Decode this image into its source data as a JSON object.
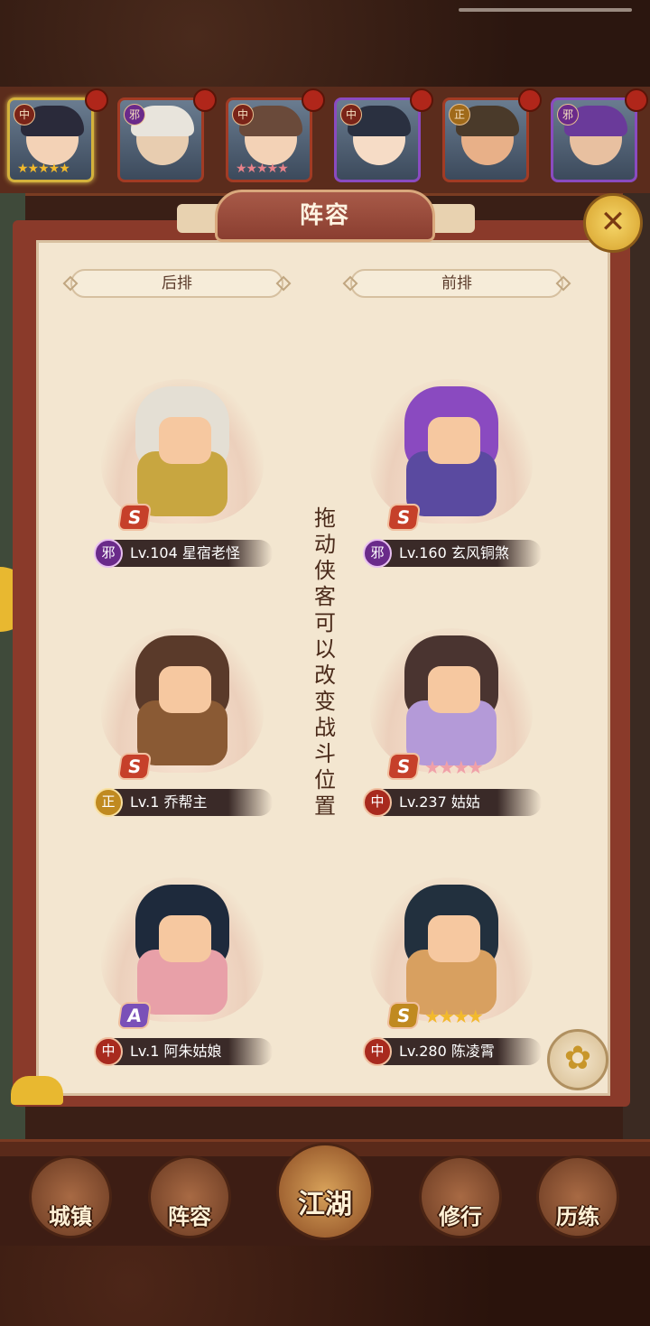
{
  "top_heroes": [
    {
      "faction": "中",
      "stars": "★★★★★",
      "star_color": "gold",
      "face": "#f3d2b6",
      "hair": "#2a2a3a"
    },
    {
      "faction": "邪",
      "stars": "",
      "star_color": "gold",
      "face": "#e8cdb0",
      "hair": "#e8e4dc"
    },
    {
      "faction": "中",
      "stars": "★★★★★",
      "star_color": "pink",
      "face": "#f3d2b6",
      "hair": "#6a4a3a"
    },
    {
      "faction": "中",
      "stars": "",
      "star_color": "gold",
      "face": "#f6dcc6",
      "hair": "#2a3040"
    },
    {
      "faction": "正",
      "stars": "",
      "star_color": "gold",
      "face": "#e8b088",
      "hair": "#4a3a2a"
    },
    {
      "faction": "邪",
      "stars": "",
      "star_color": "gold",
      "face": "#e8c0a0",
      "hair": "#6a3a9a"
    }
  ],
  "panel": {
    "title": "阵容",
    "close_icon": "✕"
  },
  "columns": {
    "back": "后排",
    "front": "前排"
  },
  "hint": "拖动侠客可以改变战斗位置",
  "formation": [
    {
      "row": "back",
      "faction": "邪",
      "faction_type": "evil",
      "level": "Lv.104",
      "name": "星宿老怪",
      "grade": "S",
      "stars": "",
      "star_color": "gold",
      "hair": "#e4dfd4",
      "body": "#c8a640"
    },
    {
      "row": "front",
      "faction": "邪",
      "faction_type": "evil",
      "level": "Lv.160",
      "name": "玄风铜煞",
      "grade": "S",
      "stars": "",
      "star_color": "gold",
      "hair": "#8a4ac0",
      "body": "#5a4aa0"
    },
    {
      "row": "back",
      "faction": "正",
      "faction_type": "good",
      "level": "Lv.1",
      "name": "乔帮主",
      "grade": "S",
      "stars": "",
      "star_color": "gold",
      "hair": "#5a3a2a",
      "body": "#8a5a34"
    },
    {
      "row": "front",
      "faction": "中",
      "faction_type": "mid",
      "level": "Lv.237",
      "name": "姑姑",
      "grade": "S",
      "stars": "★★★★",
      "star_color": "pink",
      "hair": "#4a3430",
      "body": "#b49ad8"
    },
    {
      "row": "back",
      "faction": "中",
      "faction_type": "mid",
      "level": "Lv.1",
      "name": "阿朱姑娘",
      "grade": "A",
      "stars": "",
      "star_color": "gold",
      "hair": "#1e2a3c",
      "body": "#e8a0a8"
    },
    {
      "row": "front",
      "faction": "中",
      "faction_type": "mid",
      "level": "Lv.280",
      "name": "陈凌霄",
      "grade": "S",
      "stars": "★★★★",
      "star_color": "gold",
      "hair": "#22303e",
      "body": "#d8a060"
    }
  ],
  "nav": [
    {
      "label": "城镇",
      "icon": "city-icon"
    },
    {
      "label": "阵容",
      "icon": "lineup-icon"
    },
    {
      "label": "江湖",
      "icon": "jianghu-icon",
      "active": true
    },
    {
      "label": "修行",
      "icon": "training-icon"
    },
    {
      "label": "历练",
      "icon": "adventure-icon"
    }
  ]
}
